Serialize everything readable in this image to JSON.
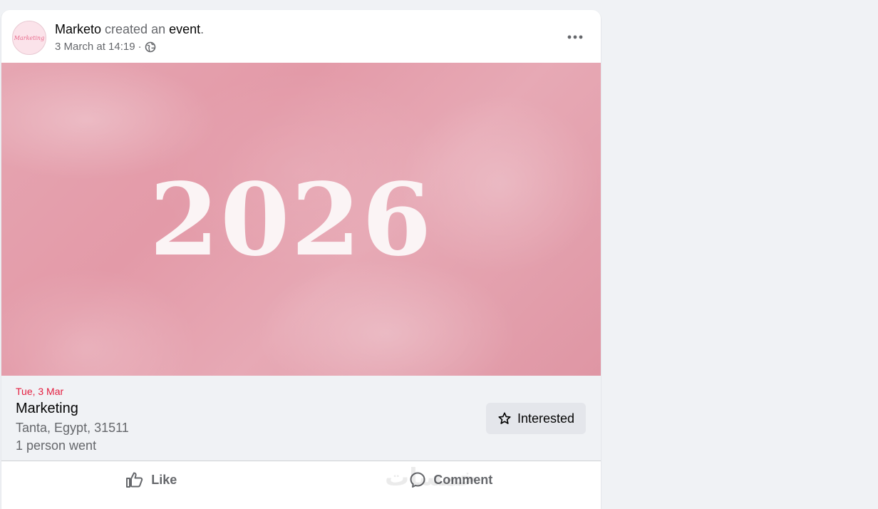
{
  "post": {
    "author": "Marketo",
    "action_text": " created an ",
    "action_object": "event",
    "period": ".",
    "timestamp": "3 March at 14:19",
    "separator": "·",
    "avatar_text": "Marketing",
    "privacy_icon": "globe-icon",
    "more_icon": "more-horizontal-icon"
  },
  "cover": {
    "headline": "2026",
    "colors": {
      "base": "#e39aa8",
      "text": "#fbf4f5"
    }
  },
  "event": {
    "date": "Tue, 3 Mar",
    "title": "Marketing",
    "location": "Tanta, Egypt, 31511",
    "attendance": "1 person went",
    "interested_label": "Interested",
    "interested_icon": "star-outline-icon",
    "date_color": "#e41e3f"
  },
  "actions": {
    "like_label": "Like",
    "like_icon": "thumbs-up-icon",
    "comment_label": "Comment",
    "comment_icon": "comment-bubble-icon"
  },
  "watermark": {
    "text": "خمسات"
  }
}
